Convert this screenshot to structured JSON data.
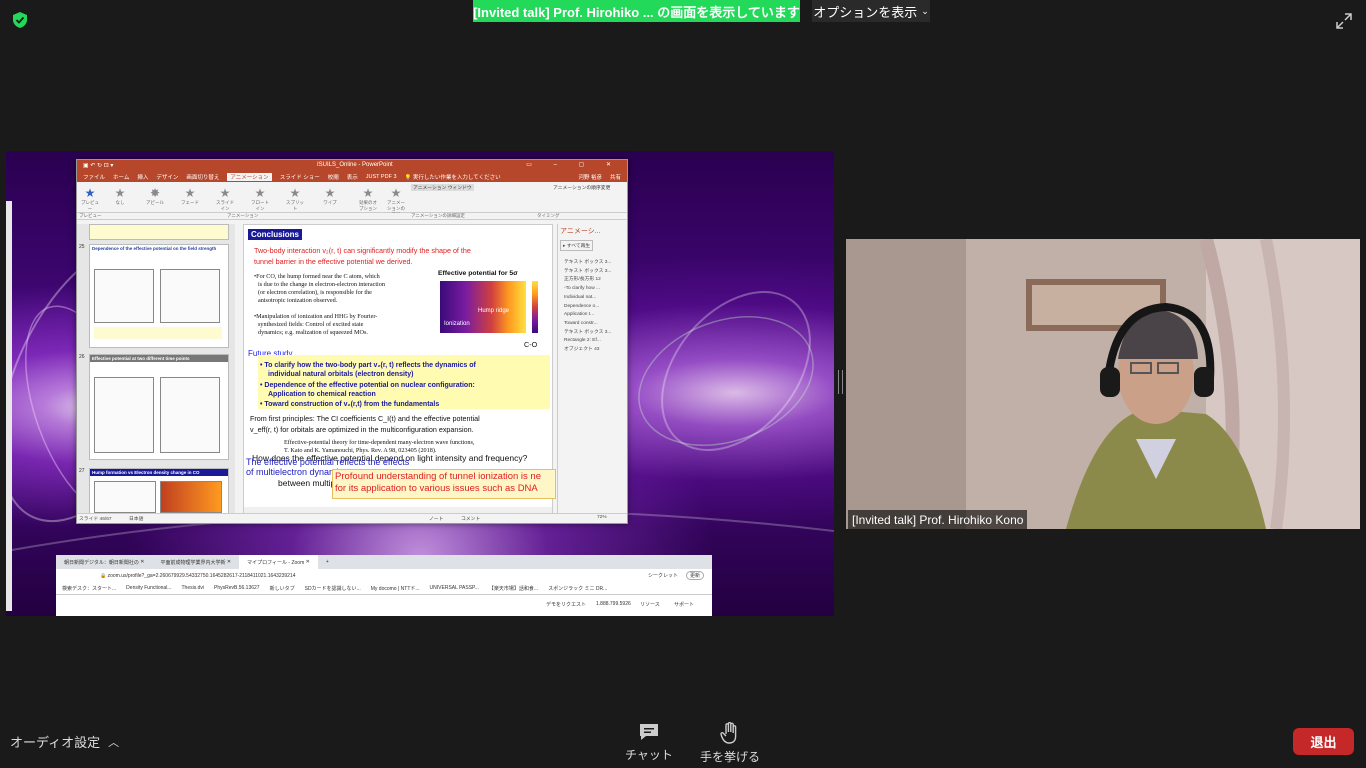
{
  "banner": {
    "sharing_text": "[Invited talk]  Prof.  Hirohiko ... の画面を表示しています",
    "options_label": "オプションを表示"
  },
  "ppt": {
    "window_title": "ISUILS_Online - PowerPoint",
    "tabs": [
      "ファイル",
      "ホーム",
      "挿入",
      "デザイン",
      "画面切り替え",
      "アニメーション",
      "スライド ショー",
      "校閲",
      "表示",
      "JUST PDF 3"
    ],
    "tell_me": "実行したい作業を入力してください",
    "user": "河野 裕彦",
    "share": "共有",
    "ribbon_effects": [
      "なし",
      "アピール",
      "フェード",
      "スライドイン",
      "フロートイン",
      "スプリット",
      "ワイプ"
    ],
    "ribbon_preview": "プレビュー",
    "ribbon_effect_options": "効果のオプション",
    "ribbon_add_anim": "アニメーションの追加",
    "ribbon_anim_window": "アニメーション ウィンドウ",
    "ribbon_group_preview": "プレビュー",
    "ribbon_group_anim": "アニメーション",
    "ribbon_group_detail": "アニメーションの詳細設定",
    "ribbon_group_timing": "タイミング",
    "ribbon_reorder": "アニメーションの順序変更",
    "thumbs": [
      {
        "num": "25",
        "title": "Dependence of the effective potential on the field strength"
      },
      {
        "num": "26",
        "title": "Effective potential at two different time points"
      },
      {
        "num": "27",
        "title": "Hump formation vs Electron density change in CO"
      }
    ],
    "slide": {
      "heading": "Conclusions",
      "line1": "Two-body interaction v₂(r, t) can significantly modify the shape of the",
      "line2": "tunnel barrier in the effective potential we derived.",
      "co1": "•For CO, the hump formed near the C atom, which",
      "co2": "is due to the change in electron-electron interaction",
      "co3": "(or  electron correlation), is responsible for the",
      "co4": "anisotropic ionization observed.",
      "m1": "•Manipulation of ionization and HHG by Fourier-",
      "m2": "synthesized fields: Control of excited state",
      "m3": "dynamics; e.g. realization of squeezed MOs.",
      "eff_title": "Effective potential for 5σ",
      "hump_label": "Hump ridge",
      "ion_label": "Ionization",
      "co_label": "C-O",
      "future": "Future study",
      "y1a": "• To clarify how the two-body part v₂(r, t) reflects the dynamics of",
      "y1b": "individual natural orbitals (electron density)",
      "y2a": "• Dependence of the effective potential on nuclear  configuration:",
      "y2b": "Application to chemical reaction",
      "y3": "• Toward construction of v₂(r,t) from the fundamentals",
      "fp1": "From first principles: The CI coefficients C_I(t) and the effective potential",
      "fp2": "v_eff(r, t) for orbitals are optimized in the multiconfiguration expansion.",
      "ref1": "Effective-potential theory for time-dependent many-electron wave functions,",
      "ref2": "T. Kato and K. Yamanouchi, Phys. Rev. A 98, 023405 (2018).",
      "over1": "How does the effective potential depend on light intensity and frequency?",
      "over2": "The effective potential reflects the effects",
      "over3": "of  multielectron dynamics",
      "over4": "between multip",
      "orange1": "Profound understanding of tunnel ionization is ne",
      "orange2": "for its application to various issues such as DNA"
    },
    "anim_pane": {
      "header": "アニメーシ...",
      "play": "すべて再生",
      "items": [
        "テキスト ボックス 3...",
        "テキスト ボックス 3...",
        "正方形/長方形 12",
        "-To clarify how ...",
        "Individual nat...",
        "Dependence o...",
        "Application t...",
        "Toward constr...",
        "テキスト ボックス 3...",
        "Rectangle 2: Ef...",
        "オブジェクト 43"
      ]
    },
    "status_slide": "スライド 46/67",
    "status_lang": "日本語",
    "status_notes": "ノート",
    "status_comments": "コメント",
    "zoom": "72%"
  },
  "browser": {
    "tabs": [
      "朝日新聞デジタル：朝日新聞社の",
      "平面前成物理学業界内大学新",
      "マイプロフィール - Zoom"
    ],
    "url": "zoom.us/profile?_ga=2.260679929.54332750.1645282617-2118411021.1643239214",
    "incognito": "シークレット",
    "update": "更新",
    "bookmarks": [
      "検索デスク：スタート...",
      "Density Functional...",
      "Thesis.dvi",
      "PhysRevB.56.13627",
      "新しいタブ",
      "SDカードを認識しない...",
      "My docomo | NTTド...",
      "UNIVERSAL PASSP...",
      "【楽天市場】話和食...",
      "スポンジラック ミニ DR..."
    ],
    "footer_links": [
      "デモをリクエスト",
      "1.888.799.5926",
      "リソース",
      "サポート"
    ]
  },
  "video": {
    "name": "[Invited talk] Prof. Hirohiko Kono"
  },
  "toolbar": {
    "audio_label": "オーディオ設定",
    "chat_label": "チャット",
    "raise_hand_label": "手を挙げる",
    "leave_label": "退出"
  }
}
